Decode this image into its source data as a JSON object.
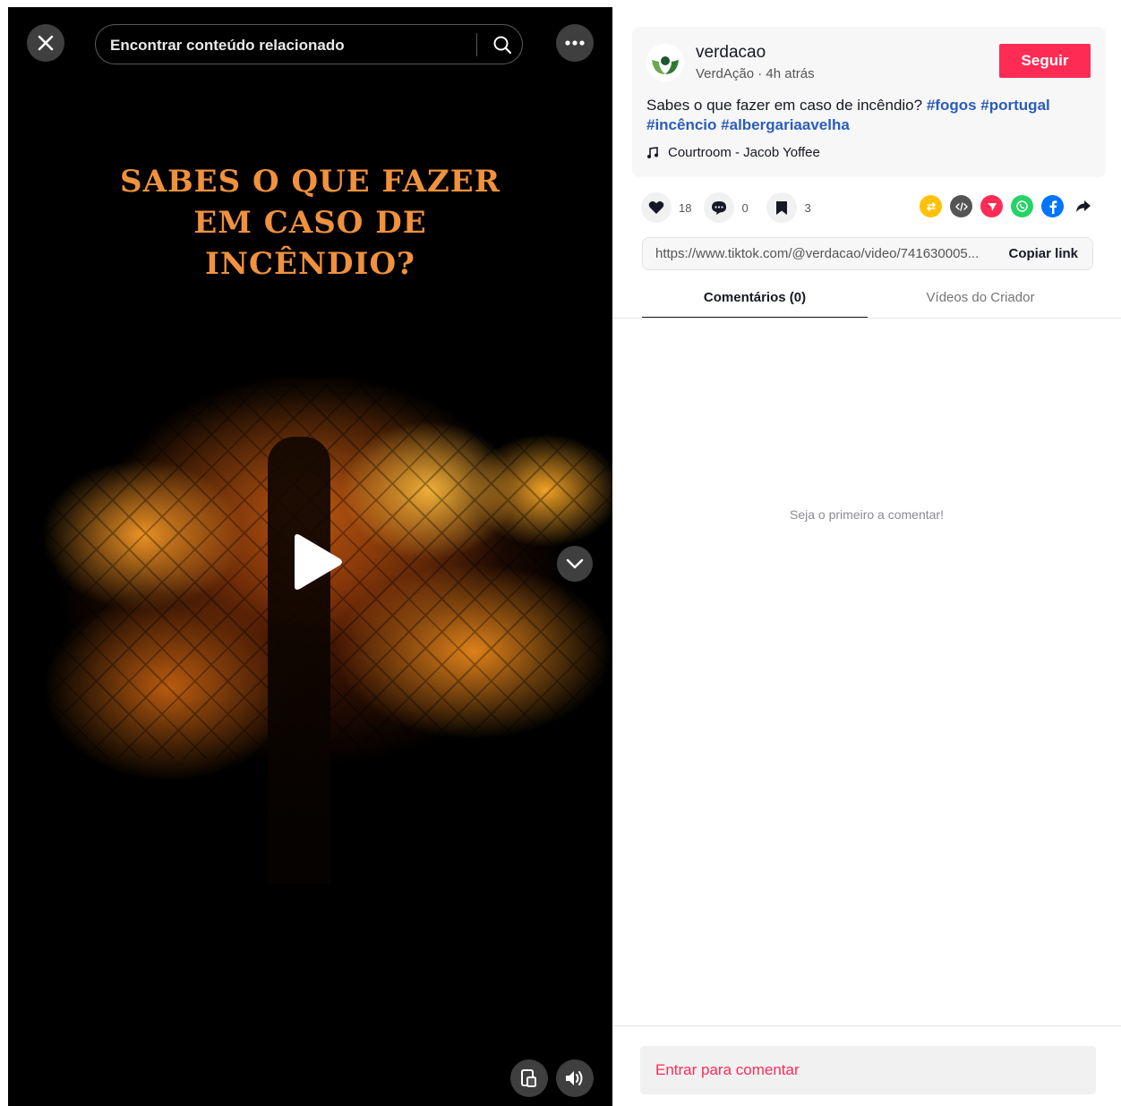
{
  "video": {
    "overlay_title_line1": "SABES O QUE FAZER",
    "overlay_title_line2": "EM CASO DE",
    "overlay_title_line3": "INCÊNDIO?",
    "playing": false
  },
  "search": {
    "placeholder": "Encontrar conteúdo relacionado"
  },
  "post": {
    "username": "verdacao",
    "display_name": "VerdAção",
    "separator": " · ",
    "time": "4h atrás",
    "follow_label": "Seguir",
    "description": "Sabes o que fazer em caso de incêndio? ",
    "hashtags": [
      "#fogos",
      "#portugal",
      "#incêncio",
      "#albergariaavelha"
    ],
    "music": "Courtroom - Jacob Yoffee"
  },
  "stats": {
    "likes": "18",
    "comments": "0",
    "saves": "3"
  },
  "share": {
    "icons": [
      "repost-icon",
      "embed-icon",
      "send-icon",
      "whatsapp-icon",
      "facebook-icon",
      "share-arrow-icon"
    ],
    "colors": {
      "repost": "#ffc107",
      "embed": "#555555",
      "send": "#fe2c55",
      "whatsapp": "#25d366",
      "facebook": "#0075fa"
    }
  },
  "link": {
    "url": "https://www.tiktok.com/@verdacao/video/741630005...",
    "copy_label": "Copiar link"
  },
  "tabs": {
    "comments": "Comentários (0)",
    "creator_videos": "Vídeos do Criador"
  },
  "comments": {
    "empty_message": "Seja o primeiro a comentar!",
    "login_prompt": "Entrar para comentar"
  },
  "colors": {
    "accent": "#fe2c55",
    "hashtag": "#2b5db9",
    "title_orange": "#f0913d"
  }
}
